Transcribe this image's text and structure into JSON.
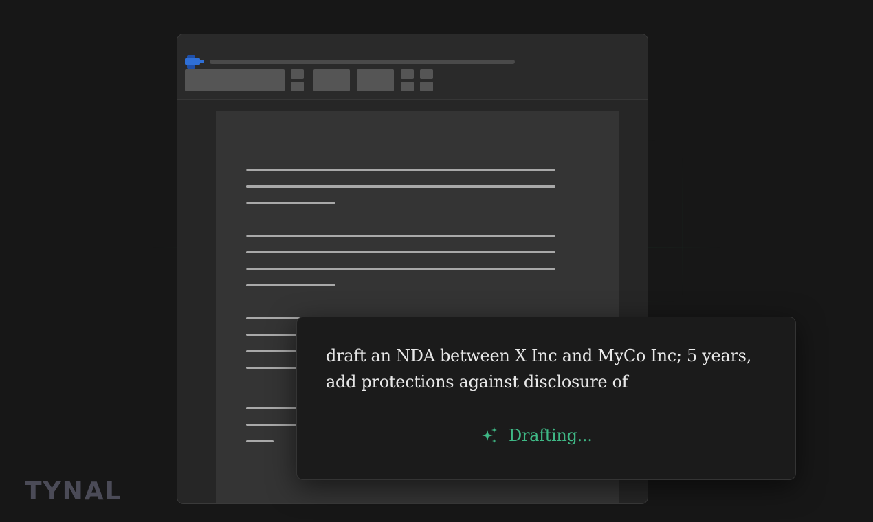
{
  "brand": {
    "logo_text": "TYNAL",
    "colors": {
      "background": "#171717",
      "accent": "#3fb986",
      "app_icon": "#2f6fd6",
      "grid": "#1f5a35"
    }
  },
  "editor": {
    "app_icon": "document-app-icon",
    "ribbon": {
      "controls": [
        "font-select",
        "small-toggle-top",
        "small-toggle-bottom",
        "button-a",
        "button-b",
        "toggle-1",
        "toggle-2",
        "toggle-3",
        "toggle-4"
      ]
    }
  },
  "prompt": {
    "text": "draft an NDA between X Inc and MyCo Inc; 5 years, add protections against disclosure of",
    "status_icon": "sparkle-icon",
    "status_label": "Drafting..."
  }
}
